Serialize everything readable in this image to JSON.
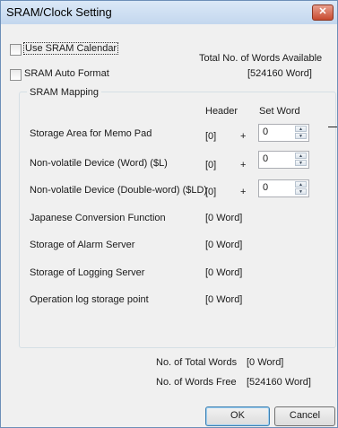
{
  "window": {
    "title": "SRAM/Clock Setting",
    "close_glyph": "✕"
  },
  "options": {
    "use_sram_calendar": {
      "label": "Use SRAM Calendar",
      "checked": false
    },
    "sram_auto_format": {
      "label": "SRAM Auto Format",
      "checked": false
    }
  },
  "total_available": {
    "label": "Total No. of Words Available",
    "value": "[524160 Word]"
  },
  "mapping": {
    "group_label": "SRAM Mapping",
    "col_header": "Header",
    "col_set_word": "Set Word",
    "plus": "+",
    "rows": [
      {
        "label": "Storage Area for Memo Pad",
        "header": "[0]",
        "set_word": "0"
      },
      {
        "label": "Non-volatile Device (Word) ($L)",
        "header": "[0]",
        "set_word": "0"
      },
      {
        "label": "Non-volatile Device (Double-word) ($LD)",
        "header": "[0]",
        "set_word": "0"
      },
      {
        "label": "Japanese Conversion Function",
        "value": "[0 Word]"
      },
      {
        "label": "Storage of Alarm Server",
        "value": "[0 Word]"
      },
      {
        "label": "Storage of Logging Server",
        "value": "[0 Word]"
      },
      {
        "label": "Operation log storage point",
        "value": "[0 Word]"
      }
    ]
  },
  "summary": {
    "total_words_label": "No. of Total Words",
    "total_words_value": "[0 Word]",
    "words_free_label": "No. of Words Free",
    "words_free_value": "[524160 Word]"
  },
  "buttons": {
    "ok": "OK",
    "cancel": "Cancel"
  },
  "icons": {
    "close": "close-icon",
    "spin_up": "spin-up-icon",
    "spin_down": "spin-down-icon"
  }
}
